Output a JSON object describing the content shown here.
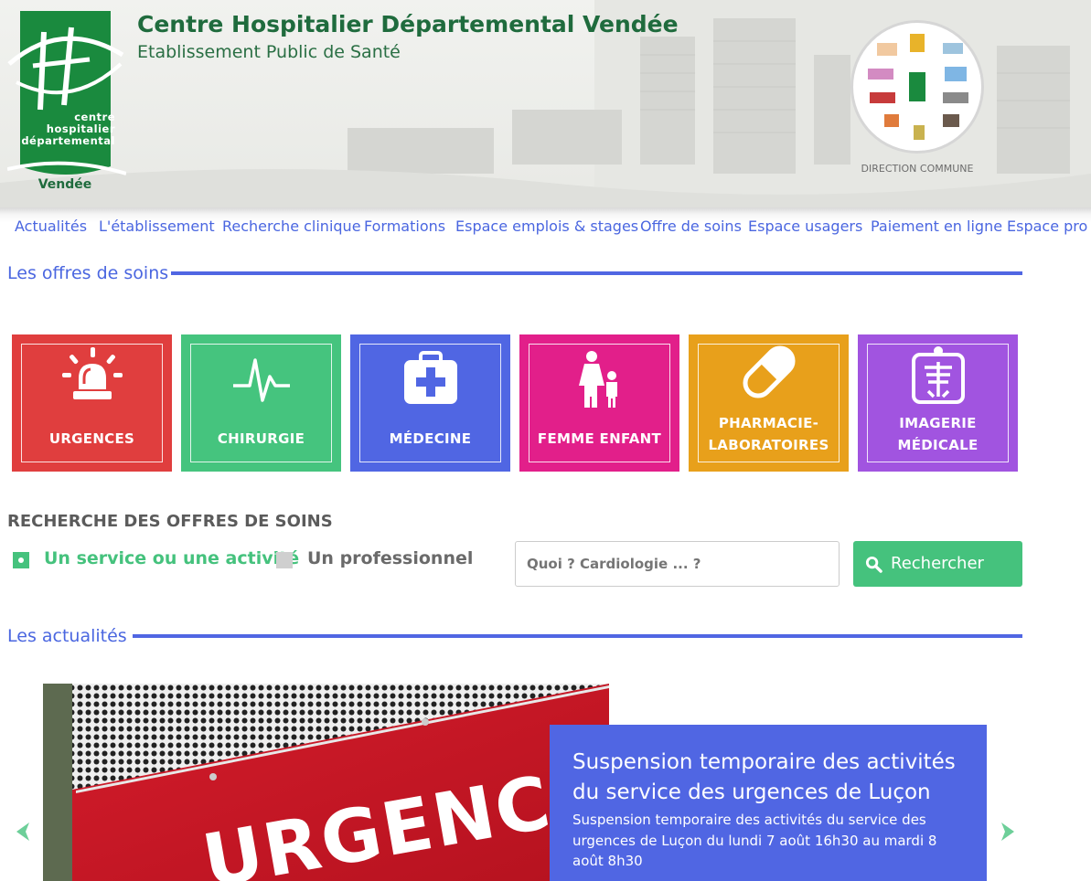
{
  "header": {
    "title": "Centre Hospitalier Départemental Vendée",
    "subtitle": "Etablissement Public de Santé",
    "logo_text": [
      "centre",
      "hospitalier",
      "départemental"
    ],
    "logo_region": "Vendée",
    "direction_label": "DIRECTION COMMUNE"
  },
  "nav": {
    "items": [
      "Actualités",
      "L'établissement",
      "Recherche clinique",
      "Formations",
      "Espace emplois & stages",
      "Offre de soins",
      "Espace usagers",
      "Paiement en ligne",
      "Espace pro"
    ]
  },
  "offres": {
    "title": "Les offres de soins",
    "tiles": [
      {
        "label": "URGENCES",
        "color": "#e03e3e",
        "icon": "siren-icon"
      },
      {
        "label": "CHIRURGIE",
        "color": "#45c47e",
        "icon": "heartbeat-icon"
      },
      {
        "label": "MÉDECINE",
        "color": "#5066e3",
        "icon": "medical-kit-icon"
      },
      {
        "label": "FEMME ENFANT",
        "color": "#e21f8a",
        "icon": "mother-child-icon"
      },
      {
        "label": "PHARMACIE-\nLABORATOIRES",
        "color": "#e8a01b",
        "icon": "pill-icon"
      },
      {
        "label": "IMAGERIE\nMÉDICALE",
        "color": "#a154e0",
        "icon": "xray-icon"
      }
    ]
  },
  "search": {
    "heading": "RECHERCHE DES OFFRES DE SOINS",
    "option_service": "Un service ou une activité",
    "option_professional": "Un professionnel",
    "placeholder": "Quoi ? Cardiologie ... ?",
    "button_label": "Rechercher",
    "selected": "service"
  },
  "news": {
    "title": "Les actualités",
    "card_title": "Suspension temporaire des activités du service des urgences de Luçon",
    "card_summary": "Suspension temporaire des activités du service des urgences de Luçon du lundi 7 août 16h30 au mardi 8 août 8h30",
    "sign_text": "URGENCE"
  },
  "colors": {
    "accent": "#5066e3",
    "green": "#45c27d",
    "brand_green": "#1f6b3d"
  }
}
